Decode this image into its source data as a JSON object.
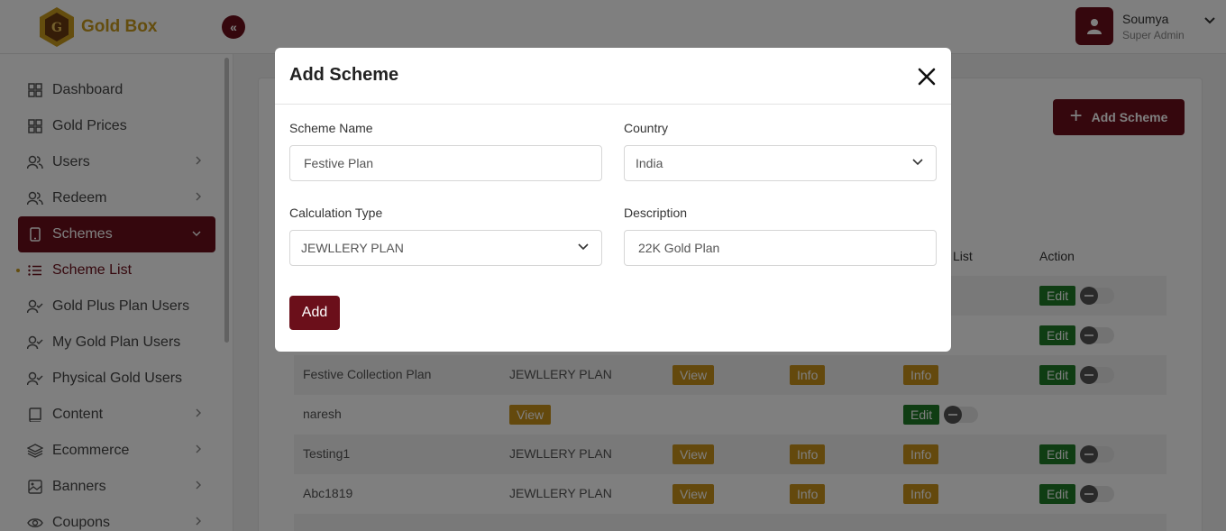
{
  "brand": {
    "name": "Gold Box",
    "color": "#c99a1d"
  },
  "accent": "#6b0f1a",
  "collapse_icon": "double-chevron-left-icon",
  "user": {
    "name": "Soumya",
    "role": "Super Admin"
  },
  "sidebar": {
    "items": [
      {
        "label": "Dashboard",
        "icon": "grid-icon"
      },
      {
        "label": "Gold Prices",
        "icon": "grid-icon"
      },
      {
        "label": "Users",
        "icon": "users-icon"
      },
      {
        "label": "Redeem",
        "icon": "users-icon"
      },
      {
        "label": "Schemes",
        "icon": "tablet-icon"
      },
      {
        "label": "Scheme List",
        "icon": "list-icon"
      },
      {
        "label": "Gold Plus Plan Users",
        "icon": "user-check-icon"
      },
      {
        "label": "My Gold Plan Users",
        "icon": "user-check-icon"
      },
      {
        "label": "Physical Gold Users",
        "icon": "user-check-icon"
      },
      {
        "label": "Content",
        "icon": "book-icon"
      },
      {
        "label": "Ecommerce",
        "icon": "layers-icon"
      },
      {
        "label": "Banners",
        "icon": "image-icon"
      },
      {
        "label": "Coupons",
        "icon": "eye-icon"
      }
    ]
  },
  "main": {
    "add_scheme_label": "Add Scheme",
    "headers": {
      "list_partial": "List",
      "action": "Action"
    },
    "rows": [
      {
        "name": "Festive Collection Plan",
        "type": "JEWLLERY PLAN",
        "view": "View",
        "info1": "Info",
        "info2": "Info",
        "edit": "Edit"
      },
      {
        "name": "naresh",
        "view": "View",
        "edit": "Edit"
      },
      {
        "name": "Testing1",
        "type": "JEWLLERY PLAN",
        "view": "View",
        "info1": "Info",
        "info2": "Info",
        "edit": "Edit"
      },
      {
        "name": "Abc1819",
        "type": "JEWLLERY PLAN",
        "view": "View",
        "info1": "Info",
        "info2": "Info",
        "edit": "Edit"
      }
    ],
    "top_edit_labels": [
      "Edit",
      "Edit"
    ]
  },
  "modal": {
    "title": "Add Scheme",
    "scheme_name_label": "Scheme Name",
    "scheme_name_value": "Festive Plan",
    "country_label": "Country",
    "country_value": "India",
    "calc_type_label": "Calculation Type",
    "calc_type_value": "JEWLLERY PLAN",
    "description_label": "Description",
    "description_value": "22K Gold Plan",
    "add_label": "Add"
  }
}
